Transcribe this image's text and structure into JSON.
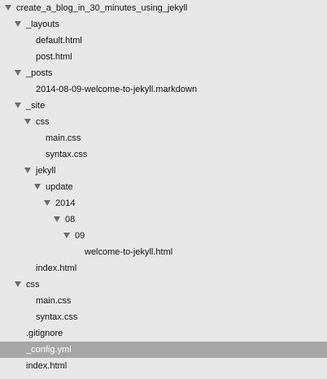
{
  "file_tree": {
    "rows": [
      {
        "label": "create_a_blog_in_30_minutes_using_jekyll",
        "type": "folder",
        "expanded": true,
        "depth": 0,
        "selected": false,
        "icon": "disclosure-triangle-down-icon"
      },
      {
        "label": "_layouts",
        "type": "folder",
        "expanded": true,
        "depth": 1,
        "selected": false,
        "icon": "disclosure-triangle-down-icon"
      },
      {
        "label": "default.html",
        "type": "file",
        "depth": 2,
        "selected": false
      },
      {
        "label": "post.html",
        "type": "file",
        "depth": 2,
        "selected": false
      },
      {
        "label": "_posts",
        "type": "folder",
        "expanded": true,
        "depth": 1,
        "selected": false,
        "icon": "disclosure-triangle-down-icon"
      },
      {
        "label": "2014-08-09-welcome-to-jekyll.markdown",
        "type": "file",
        "depth": 2,
        "selected": false
      },
      {
        "label": "_site",
        "type": "folder",
        "expanded": true,
        "depth": 1,
        "selected": false,
        "icon": "disclosure-triangle-down-icon"
      },
      {
        "label": "css",
        "type": "folder",
        "expanded": true,
        "depth": 2,
        "selected": false,
        "icon": "disclosure-triangle-down-icon"
      },
      {
        "label": "main.css",
        "type": "file",
        "depth": 3,
        "selected": false
      },
      {
        "label": "syntax.css",
        "type": "file",
        "depth": 3,
        "selected": false
      },
      {
        "label": "jekyll",
        "type": "folder",
        "expanded": true,
        "depth": 2,
        "selected": false,
        "icon": "disclosure-triangle-down-icon"
      },
      {
        "label": "update",
        "type": "folder",
        "expanded": true,
        "depth": 3,
        "selected": false,
        "icon": "disclosure-triangle-down-icon"
      },
      {
        "label": "2014",
        "type": "folder",
        "expanded": true,
        "depth": 4,
        "selected": false,
        "icon": "disclosure-triangle-down-icon"
      },
      {
        "label": "08",
        "type": "folder",
        "expanded": true,
        "depth": 5,
        "selected": false,
        "icon": "disclosure-triangle-down-icon"
      },
      {
        "label": "09",
        "type": "folder",
        "expanded": true,
        "depth": 6,
        "selected": false,
        "icon": "disclosure-triangle-down-icon"
      },
      {
        "label": "welcome-to-jekyll.html",
        "type": "file",
        "depth": 7,
        "selected": false
      },
      {
        "label": "index.html",
        "type": "file",
        "depth": 2,
        "selected": false
      },
      {
        "label": "css",
        "type": "folder",
        "expanded": true,
        "depth": 1,
        "selected": false,
        "icon": "disclosure-triangle-down-icon"
      },
      {
        "label": "main.css",
        "type": "file",
        "depth": 2,
        "selected": false
      },
      {
        "label": "syntax.css",
        "type": "file",
        "depth": 2,
        "selected": false
      },
      {
        "label": ".gitignore",
        "type": "file",
        "depth": 1,
        "selected": false
      },
      {
        "label": "_config.yml",
        "type": "file",
        "depth": 1,
        "selected": true
      },
      {
        "label": "index.html",
        "type": "file",
        "depth": 1,
        "selected": false
      }
    ]
  },
  "colors": {
    "background": "#e8e8e8",
    "selection": "#a7a7a7",
    "triangle": "#6c6c6c",
    "text": "#111111",
    "selected_text": "#ffffff"
  }
}
